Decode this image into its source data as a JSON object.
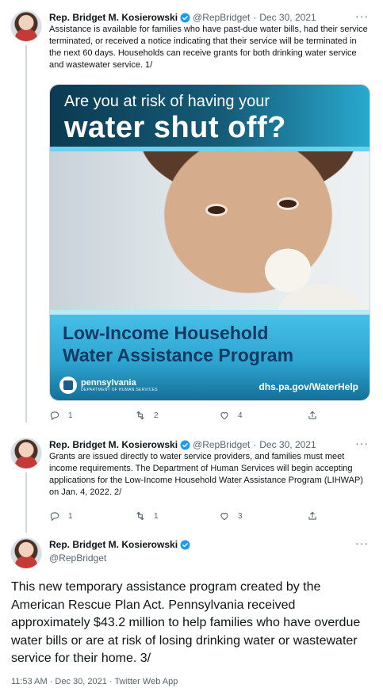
{
  "tweets": [
    {
      "author_name": "Rep. Bridget M. Kosierowski",
      "handle": "@RepBridget",
      "separator": "·",
      "date": "Dec 30, 2021",
      "more": "···",
      "text": "Assistance is available for families who have past-due water bills, had their service terminated, or received a notice indicating that their service will be terminated in the next 60 days. Households can receive grants for both drinking water service and wastewater service. 1/",
      "media": {
        "headline_line1": "Are you at risk of having your",
        "headline_line2": "water shut off?",
        "program_line1": "Low-Income Household",
        "program_line2": "Water Assistance Program",
        "logo_name": "pennsylvania",
        "logo_subtitle": "DEPARTMENT OF HUMAN SERVICES",
        "url": "dhs.pa.gov/WaterHelp"
      },
      "replies": "1",
      "retweets": "2",
      "likes": "4"
    },
    {
      "author_name": "Rep. Bridget M. Kosierowski",
      "handle": "@RepBridget",
      "separator": "·",
      "date": "Dec 30, 2021",
      "more": "···",
      "text": "Grants are issued directly to water service providers, and families must meet income requirements. The Department of Human Services will begin accepting applications for the Low-Income Household Water Assistance Program (LIHWAP) on Jan. 4, 2022. 2/",
      "replies": "1",
      "retweets": "1",
      "likes": "3"
    },
    {
      "author_name": "Rep. Bridget M. Kosierowski",
      "handle": "@RepBridget",
      "more": "···",
      "text": "This new temporary assistance program created by the American Rescue Plan Act. Pennsylvania received approximately $43.2 million to help families who have overdue water bills or are at risk of losing drinking water or wastewater service for their home. 3/",
      "meta": "11:53 AM · Dec 30, 2021 · Twitter Web App"
    }
  ],
  "colors": {
    "verified": "#1d9bf0",
    "secondary_text": "#536471",
    "thread_line": "#cfd9de"
  },
  "icons": [
    "reply-icon",
    "retweet-icon",
    "like-icon",
    "share-icon",
    "verified-badge-icon",
    "more-icon"
  ]
}
